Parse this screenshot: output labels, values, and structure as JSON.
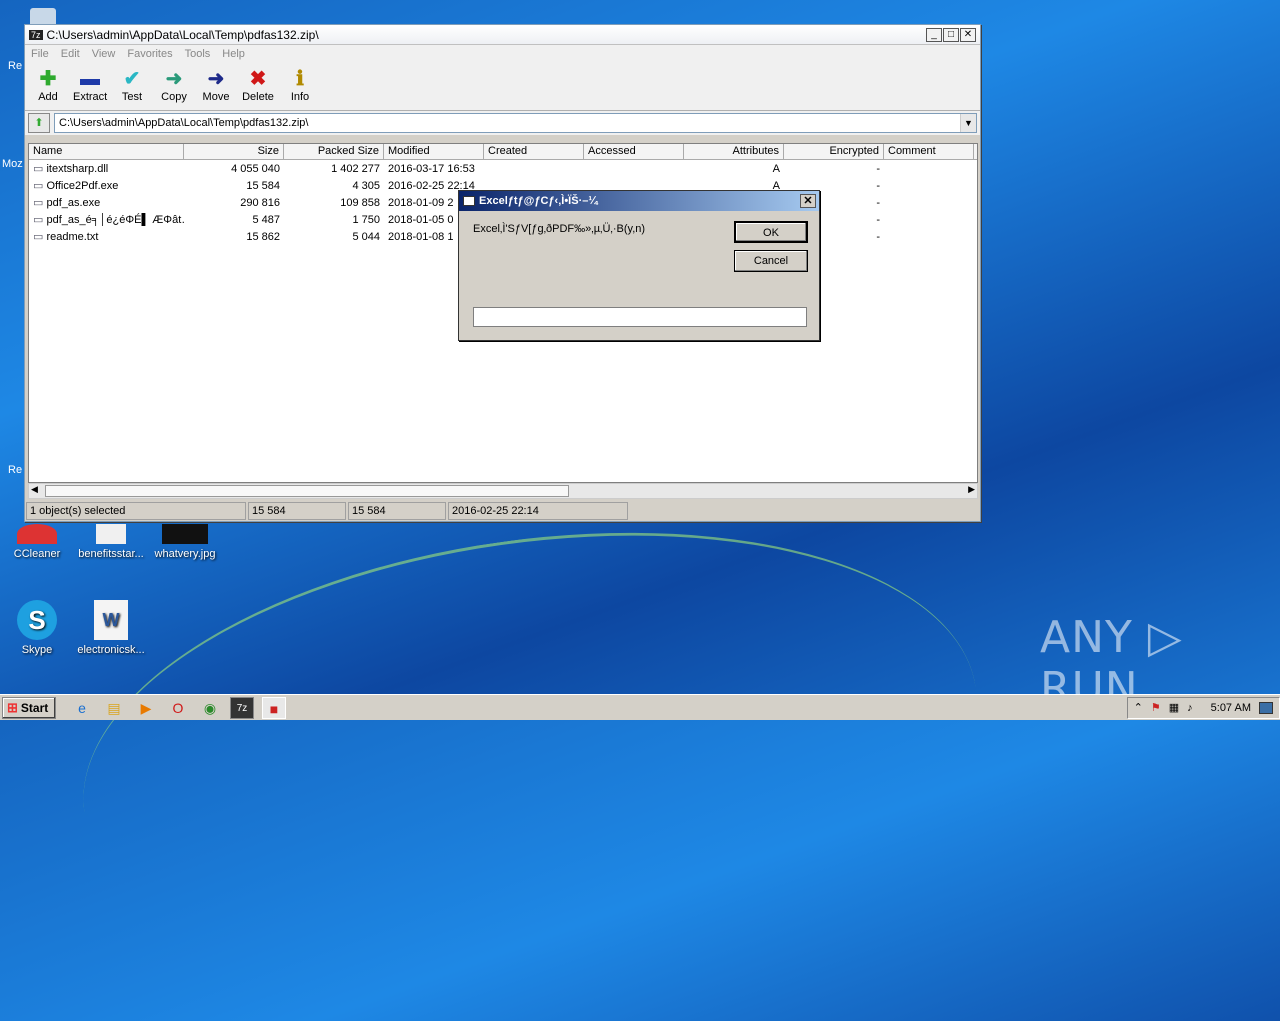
{
  "window": {
    "title": "C:\\Users\\admin\\AppData\\Local\\Temp\\pdfas132.zip\\",
    "menu": [
      "File",
      "Edit",
      "View",
      "Favorites",
      "Tools",
      "Help"
    ],
    "toolbar": [
      {
        "label": "Add",
        "icon": "add-icon",
        "glyph": "✚",
        "color": "#2eaa2e"
      },
      {
        "label": "Extract",
        "icon": "extract-icon",
        "glyph": "▬",
        "color": "#1e3aa8"
      },
      {
        "label": "Test",
        "icon": "test-icon",
        "glyph": "✔",
        "color": "#2ab7c4"
      },
      {
        "label": "Copy",
        "icon": "copy-icon",
        "glyph": "➜",
        "color": "#2a9a7a"
      },
      {
        "label": "Move",
        "icon": "move-icon",
        "glyph": "➜",
        "color": "#1e2a8a"
      },
      {
        "label": "Delete",
        "icon": "delete-icon",
        "glyph": "✖",
        "color": "#d01818"
      },
      {
        "label": "Info",
        "icon": "info-icon",
        "glyph": "ℹ",
        "color": "#b08a00"
      }
    ],
    "address": "C:\\Users\\admin\\AppData\\Local\\Temp\\pdfas132.zip\\",
    "columns": [
      "Name",
      "Size",
      "Packed Size",
      "Modified",
      "Created",
      "Accessed",
      "Attributes",
      "Encrypted",
      "Comment"
    ],
    "rows": [
      {
        "name": "itextsharp.dll",
        "size": "4 055 040",
        "packed": "1 402 277",
        "modified": "2016-03-17 16:53",
        "attr": "A",
        "enc": "-"
      },
      {
        "name": "Office2Pdf.exe",
        "size": "15 584",
        "packed": "4 305",
        "modified": "2016-02-25 22:14",
        "attr": "A",
        "enc": "-"
      },
      {
        "name": "pdf_as.exe",
        "size": "290 816",
        "packed": "109 858",
        "modified": "2018-01-09 2",
        "attr": "",
        "enc": "-"
      },
      {
        "name": "pdf_as_é╕│é¿éΦÉ▌ ÆΦât…",
        "size": "5 487",
        "packed": "1 750",
        "modified": "2018-01-05 0",
        "attr": "",
        "enc": "-"
      },
      {
        "name": "readme.txt",
        "size": "15 862",
        "packed": "5 044",
        "modified": "2018-01-08 1",
        "attr": "",
        "enc": "-"
      }
    ],
    "status": [
      "1 object(s) selected",
      "15 584",
      "15 584",
      "2016-02-25 22:14"
    ]
  },
  "dialog": {
    "title": "Excelƒtƒ@ƒCƒ‹‚Ì•ÏŠ·–¼",
    "message": "Excel‚Ì'SƒV[ƒg‚ðPDF‰»‚µ‚Ü‚·B(y,n)",
    "ok": "OK",
    "cancel": "Cancel",
    "input_value": ""
  },
  "desktop": {
    "icons": [
      "CCleaner",
      "benefitsstar...",
      "whatvery.jpg",
      "Skype",
      "electronicsk..."
    ],
    "edge_labels": [
      "Re",
      "Moz",
      "Re"
    ],
    "watermark": "ANY ▷ RUN"
  },
  "taskbar": {
    "start": "Start",
    "clock": "5:07 AM"
  }
}
